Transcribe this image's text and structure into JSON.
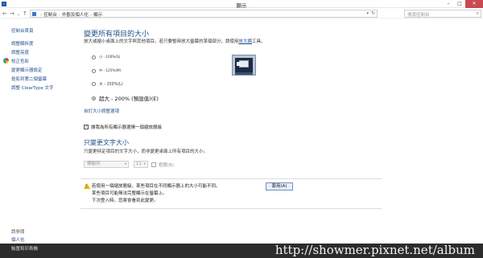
{
  "window": {
    "title": "顯示",
    "minimize": "–",
    "maximize": "□",
    "close": "✕"
  },
  "nav": {
    "back": "←",
    "forward": "→",
    "recent": "⌄",
    "up": "↑",
    "breadcrumbs": [
      "控制台",
      "外觀及個人化",
      "顯示"
    ],
    "search_placeholder": "搜尋控制台"
  },
  "sidebar": {
    "home": "控制台首頁",
    "items": [
      "調整解析度",
      "調整亮度",
      "校正色彩",
      "變更顯示器設定",
      "投影到第二個螢幕",
      "調整 ClearType 文字"
    ],
    "see_also": "請參閱",
    "bottom_items": [
      "個人化"
    ],
    "bottom_dark": "裝置和印表機"
  },
  "main": {
    "heading": "變更所有項目的大小",
    "desc_prefix": "放大或縮小桌面上的文字與其他項目。若只要暫時放大螢幕的某個部分，請使用",
    "desc_link": "放大鏡",
    "desc_suffix": "工具。",
    "options": [
      {
        "label": "小 - 100%(S)",
        "selected": false
      },
      {
        "label": "中 - 125%(M)",
        "selected": false
      },
      {
        "label": "大 - 150%(L)",
        "selected": false
      },
      {
        "label": "超大 - 200% (預設值)(E)",
        "selected": true
      }
    ],
    "custom_link": "自訂大小調整選項",
    "checkbox_label": "讓我為所有顯示器選擇一個縮放層級",
    "checkbox_checked": "✓",
    "heading2": "只變更文字大小",
    "desc2": "只變更特定項目的文字大小，而非變更桌面上所有項目的大小。",
    "item_select": "標題列",
    "size_select": "11",
    "dropdown_arrow": "▾",
    "bold_label": "粗體(B)",
    "notice": [
      "若使用一個縮放層級，某些項目在不同顯示器上的大小可能不同。",
      "某些項目可能無法完整顯示在螢幕上。",
      "下次登入時，您將會看到此變更。"
    ],
    "warning_mark": "!",
    "apply_button": "套用(A)"
  },
  "watermark": "http://showmer.pixnet.net/album"
}
